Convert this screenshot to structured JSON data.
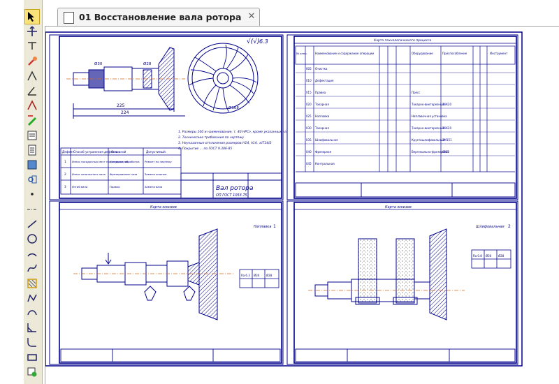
{
  "document": {
    "tab_title": "01 Восстановление вала ротора"
  },
  "toolbar": {
    "tools": [
      {
        "name": "select-icon",
        "active": true
      },
      {
        "name": "pan-icon"
      },
      {
        "name": "distance-icon"
      },
      {
        "name": "wrench-icon"
      },
      {
        "name": "dimension-icon"
      },
      {
        "name": "measure-angle-icon"
      },
      {
        "name": "vertex-icon"
      },
      {
        "name": "edit-icon"
      },
      {
        "name": "spec-icon"
      },
      {
        "name": "report-icon"
      },
      {
        "name": "view-icon"
      },
      {
        "name": "library-icon"
      },
      {
        "name": "point-icon"
      },
      {
        "name": "axis-icon"
      },
      {
        "name": "line-icon"
      },
      {
        "name": "circle-icon"
      },
      {
        "name": "arc-icon"
      },
      {
        "name": "spline-icon"
      },
      {
        "name": "hatch-icon"
      },
      {
        "name": "polyline-icon"
      },
      {
        "name": "bezier-icon"
      },
      {
        "name": "chamfer-icon"
      },
      {
        "name": "fillet-icon"
      },
      {
        "name": "rectangle-icon"
      },
      {
        "name": "macro-icon"
      }
    ]
  },
  "sheet1": {
    "title": "Вал ротора",
    "doc_number": "ОП ГОСТ 1053.75",
    "surface_finish": "√(√)",
    "surface_value": "6.3",
    "dimension_labels": [
      "225",
      "224",
      "Ø30",
      "Ø28",
      "Ø168"
    ],
    "notes": [
      "1. Размеры 100 и наименование, т. 40 НРСэ, кроме указанных на 1 ст. оси",
      "2. Технические требования по чертежу",
      "3. Неуказанные отклонения размеров Н14, h14, ±IT14/2",
      "4. Покрытие ... по ГОСТ 9.306-85"
    ],
    "table_header": [
      "Дефект",
      "Способ устранения дефекта",
      "Основной",
      "Допустимый"
    ],
    "table_rows": [
      [
        "1",
        "Износ посадочных мест под подшипник",
        "Наплавка, обработка",
        "Ремонт по чертежу"
      ],
      [
        "2",
        "Износ шпоночного паза",
        "Фрезерование паза",
        "Замена шпонки"
      ],
      [
        "3",
        "Изгиб вала",
        "Правка",
        "Замена вала"
      ]
    ]
  },
  "sheet2": {
    "title": "Карта технологического процесса",
    "header_labels": [
      "№ опер.",
      "Наименование и содержание операции",
      "Оборудование",
      "Приспособление",
      "Инструмент"
    ],
    "rows": [
      [
        "005",
        "Очистка",
        "",
        ""
      ],
      [
        "010",
        "Дефектация",
        "",
        ""
      ],
      [
        "015",
        "Правка",
        "Пресс",
        ""
      ],
      [
        "020",
        "Токарная",
        "Токарно-винторезный",
        "16К20"
      ],
      [
        "025",
        "Наплавка",
        "Наплавочная установка",
        ""
      ],
      [
        "030",
        "Токарная",
        "Токарно-винторезный",
        "16К20"
      ],
      [
        "035",
        "Шлифовальная",
        "Круглошлифовальный",
        "3М151"
      ],
      [
        "040",
        "Фрезерная",
        "Вертикально-фрезерный",
        "6Р12"
      ],
      [
        "045",
        "Контрольная",
        "",
        ""
      ]
    ]
  },
  "sheet3": {
    "title": "Карта эскизов",
    "caption": "Наплавка",
    "tolerance": [
      "Ra 6.3",
      "Ø30",
      "Ø28"
    ],
    "stamp": "1"
  },
  "sheet4": {
    "title": "Карта эскизов",
    "caption": "Шлифовальная",
    "tolerance": [
      "Ra 0.8",
      "Ø30",
      "Ø28"
    ],
    "stamp": "2"
  }
}
